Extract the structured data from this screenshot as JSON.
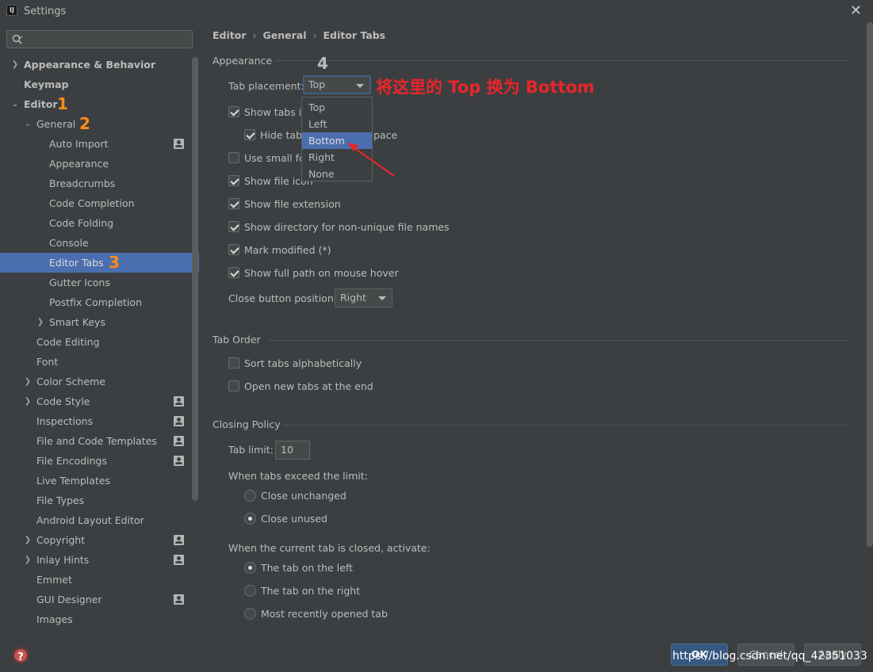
{
  "window": {
    "title": "Settings",
    "logo_text": "IJ"
  },
  "search": {
    "placeholder": ""
  },
  "sidebar": {
    "items": [
      {
        "label": "Appearance & Behavior"
      },
      {
        "label": "Keymap"
      },
      {
        "label": "Editor",
        "annotation": "1"
      },
      {
        "label": "General",
        "annotation": "2"
      },
      {
        "label": "Auto Import"
      },
      {
        "label": "Appearance"
      },
      {
        "label": "Breadcrumbs"
      },
      {
        "label": "Code Completion"
      },
      {
        "label": "Code Folding"
      },
      {
        "label": "Console"
      },
      {
        "label": "Editor Tabs",
        "annotation": "3"
      },
      {
        "label": "Gutter Icons"
      },
      {
        "label": "Postfix Completion"
      },
      {
        "label": "Smart Keys"
      },
      {
        "label": "Code Editing"
      },
      {
        "label": "Font"
      },
      {
        "label": "Color Scheme"
      },
      {
        "label": "Code Style"
      },
      {
        "label": "Inspections"
      },
      {
        "label": "File and Code Templates"
      },
      {
        "label": "File Encodings"
      },
      {
        "label": "Live Templates"
      },
      {
        "label": "File Types"
      },
      {
        "label": "Android Layout Editor"
      },
      {
        "label": "Copyright"
      },
      {
        "label": "Inlay Hints"
      },
      {
        "label": "Emmet"
      },
      {
        "label": "GUI Designer"
      },
      {
        "label": "Images"
      }
    ]
  },
  "breadcrumb": [
    "Editor",
    "General",
    "Editor Tabs"
  ],
  "appearance": {
    "title": "Appearance",
    "annotation": "4",
    "tab_placement_label": "Tab placement:",
    "tab_placement_value": "Top",
    "show_tabs_in": "Show tabs in",
    "hide_tabs": "Hide tabs",
    "hide_tabs_suffix": "pace",
    "use_small_font": "Use small fo",
    "show_file_icon": "Show file icon",
    "show_file_extension": "Show file extension",
    "show_directory": "Show directory for non-unique file names",
    "mark_modified": "Mark modified (*)",
    "show_full_path": "Show full path on mouse hover",
    "close_button_label": "Close button position:",
    "close_button_value": "Right"
  },
  "dropdown": {
    "options": [
      "Top",
      "Left",
      "Bottom",
      "Right",
      "None"
    ],
    "highlighted": "Bottom"
  },
  "annotation_text": "将这里的 Top 换为 Bottom",
  "tab_order": {
    "title": "Tab Order",
    "sort_alpha": "Sort tabs alphabetically",
    "open_at_end": "Open new tabs at the end"
  },
  "closing_policy": {
    "title": "Closing Policy",
    "tab_limit_label": "Tab limit:",
    "tab_limit_value": "10",
    "exceed_label": "When tabs exceed the limit:",
    "close_unchanged": "Close unchanged",
    "close_unused": "Close unused",
    "closed_label": "When the current tab is closed, activate:",
    "tab_left": "The tab on the left",
    "tab_right": "The tab on the right",
    "most_recent": "Most recently opened tab"
  },
  "buttons": {
    "help": "?",
    "ok": "OK",
    "cancel": "Cancel",
    "apply": "Apply"
  },
  "watermark": "https://blog.csdn.net/qq_42351033"
}
